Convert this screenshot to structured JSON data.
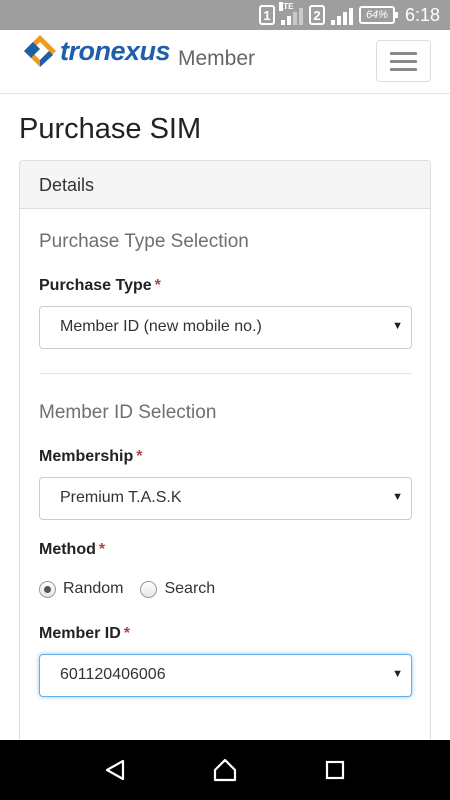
{
  "status_bar": {
    "sim1": "1",
    "sim2": "2",
    "lte": "LTE",
    "battery": "64%",
    "time": "6:18"
  },
  "navbar": {
    "brand": "tronexus",
    "brand_sub": "Member",
    "menu_icon": "hamburger-icon"
  },
  "page": {
    "title": "Purchase SIM"
  },
  "panel": {
    "heading": "Details",
    "purchase_type_section": "Purchase Type Selection",
    "purchase_type_label": "Purchase Type",
    "purchase_type_value": "Member ID (new mobile no.)",
    "member_id_section": "Member ID Selection",
    "membership_label": "Membership",
    "membership_value": "Premium T.A.S.K",
    "method_label": "Method",
    "method_options": [
      "Random",
      "Search"
    ],
    "method_selected": "Random",
    "member_id_label": "Member ID",
    "member_id_value": "601120406006",
    "required_mark": "*",
    "caret": "▼"
  },
  "colors": {
    "brand_blue": "#1f5ea8",
    "brand_orange": "#f39a1e",
    "required_red": "#a94442",
    "focus_blue": "#66afe9"
  },
  "android_nav": {
    "back_icon": "back-triangle-icon",
    "home_icon": "home-icon",
    "recents_icon": "recents-square-icon"
  }
}
